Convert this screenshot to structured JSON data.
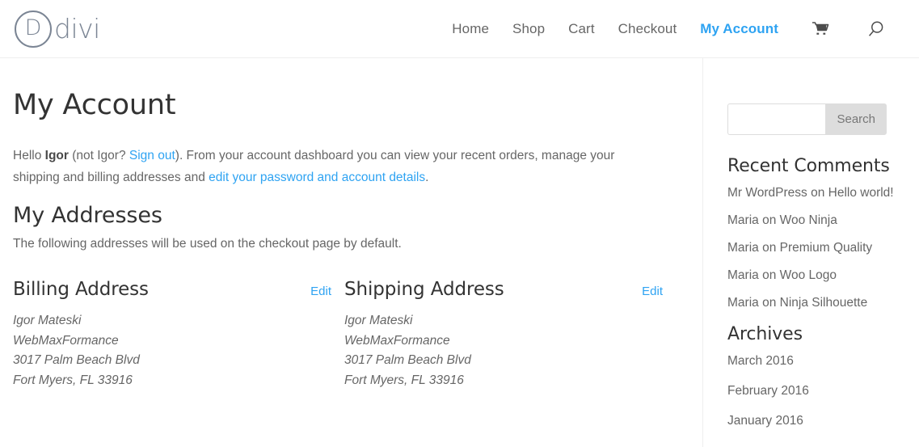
{
  "header": {
    "logo": {
      "mark": "D",
      "text": "divi"
    },
    "nav": [
      {
        "label": "Home",
        "active": false
      },
      {
        "label": "Shop",
        "active": false
      },
      {
        "label": "Cart",
        "active": false
      },
      {
        "label": "Checkout",
        "active": false
      },
      {
        "label": "My Account",
        "active": true
      }
    ],
    "icons": [
      {
        "name": "cart-icon"
      },
      {
        "name": "search-icon"
      }
    ]
  },
  "main": {
    "page_title": "My Account",
    "intro": {
      "hello": "Hello ",
      "user": "Igor",
      "not_user": " (not Igor? ",
      "sign_out": "Sign out",
      "after_sign_out": "). From your account dashboard you can view your recent orders, manage your shipping and billing addresses and ",
      "edit_details": "edit your password and account details",
      "period": "."
    },
    "addresses_title": "My Addresses",
    "addresses_sub": "The following addresses will be used on the checkout page by default.",
    "addresses": [
      {
        "title": "Billing Address",
        "edit_label": "Edit",
        "lines": [
          "Igor Mateski",
          "WebMaxFormance",
          "3017 Palm Beach Blvd",
          "Fort Myers, FL 33916"
        ]
      },
      {
        "title": "Shipping Address",
        "edit_label": "Edit",
        "lines": [
          "Igor Mateski",
          "WebMaxFormance",
          "3017 Palm Beach Blvd",
          "Fort Myers, FL 33916"
        ]
      }
    ]
  },
  "sidebar": {
    "search": {
      "value": "",
      "placeholder": "",
      "button_label": "Search"
    },
    "recent_comments": {
      "title": "Recent Comments",
      "items": [
        {
          "author": "Mr WordPress",
          "on": " on ",
          "post": "Hello world!"
        },
        {
          "author": "Maria",
          "on": " on ",
          "post": "Woo Ninja"
        },
        {
          "author": "Maria",
          "on": " on ",
          "post": "Premium Quality"
        },
        {
          "author": "Maria",
          "on": " on ",
          "post": "Woo Logo"
        },
        {
          "author": "Maria",
          "on": " on ",
          "post": "Ninja Silhouette"
        }
      ]
    },
    "archives": {
      "title": "Archives",
      "items": [
        "March 2016",
        "February 2016",
        "January 2016"
      ]
    }
  },
  "colors": {
    "accent": "#2ea3f2",
    "heading": "#333333",
    "body": "#666666",
    "logo": "#7b8594",
    "border": "#eeeeee",
    "button_bg": "#dddddd"
  }
}
